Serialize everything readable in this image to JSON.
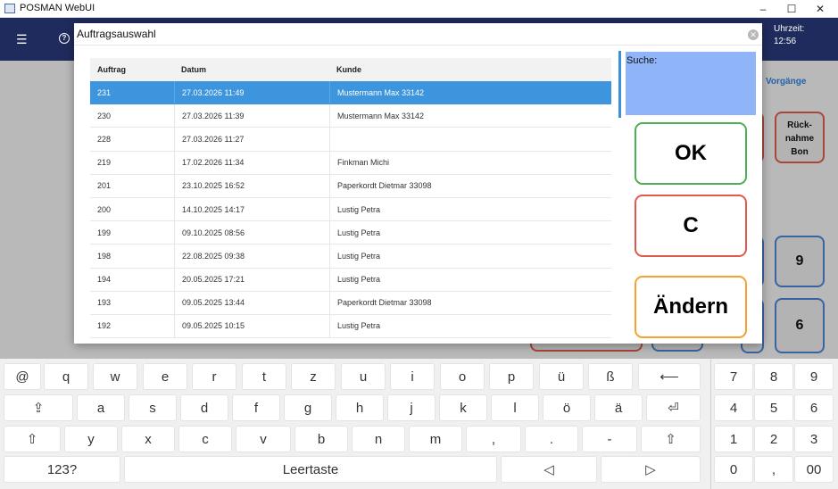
{
  "window": {
    "title": "POSMAN WebUI",
    "minimize": "–",
    "maximize": "☐",
    "close": "✕"
  },
  "header": {
    "menu_icon": "menu-icon",
    "info_icon": "info-icon",
    "time_label": "Uhrzeit:",
    "time_value": "12:56"
  },
  "background": {
    "tab_label": "Vorgänge",
    "tile_ruecknahme": "Rück-\nnahme\nBon",
    "tile_9": "9",
    "tile_6": "6"
  },
  "dialog": {
    "title": "Auftragsauswahl",
    "close_icon": "close-icon",
    "columns": [
      "Auftrag",
      "Datum",
      "Kunde"
    ],
    "rows": [
      {
        "auftrag": "231",
        "datum": "27.03.2026 11:49",
        "kunde": "Mustermann Max 33142",
        "selected": true
      },
      {
        "auftrag": "230",
        "datum": "27.03.2026 11:39",
        "kunde": "Mustermann Max 33142"
      },
      {
        "auftrag": "228",
        "datum": "27.03.2026 11:27",
        "kunde": ""
      },
      {
        "auftrag": "219",
        "datum": "17.02.2026 11:34",
        "kunde": "Finkman Michi"
      },
      {
        "auftrag": "201",
        "datum": "23.10.2025 16:52",
        "kunde": "Paperkordt Dietmar 33098"
      },
      {
        "auftrag": "200",
        "datum": "14.10.2025 14:17",
        "kunde": "Lustig Petra"
      },
      {
        "auftrag": "199",
        "datum": "09.10.2025 08:56",
        "kunde": "Lustig Petra"
      },
      {
        "auftrag": "198",
        "datum": "22.08.2025 09:38",
        "kunde": "Lustig Petra"
      },
      {
        "auftrag": "194",
        "datum": "20.05.2025 17:21",
        "kunde": "Lustig Petra"
      },
      {
        "auftrag": "193",
        "datum": "09.05.2025 13:44",
        "kunde": "Paperkordt Dietmar 33098"
      },
      {
        "auftrag": "192",
        "datum": "09.05.2025 10:15",
        "kunde": "Lustig Petra"
      }
    ],
    "search_label": "Suche:",
    "ok_label": "OK",
    "clear_label": "C",
    "edit_label": "Ändern"
  },
  "colors": {
    "ok_border": "#4caf50",
    "clear_border": "#e05a4a",
    "edit_border": "#f5a030",
    "selection": "#3d95de",
    "header": "#1f2b5c",
    "search_bg": "#8fb4f8"
  },
  "keyboard": {
    "row1": [
      "@",
      "q",
      "w",
      "e",
      "r",
      "t",
      "z",
      "u",
      "i",
      "o",
      "p",
      "ü",
      "ß",
      "⟵"
    ],
    "row2": [
      "⇪",
      "a",
      "s",
      "d",
      "f",
      "g",
      "h",
      "j",
      "k",
      "l",
      "ö",
      "ä",
      "⏎"
    ],
    "row3": [
      "⇧",
      "y",
      "x",
      "c",
      "v",
      "b",
      "n",
      "m",
      ",",
      ".",
      "-",
      "⇧"
    ],
    "row4": [
      "123?",
      "Leertaste",
      "◁",
      "▷"
    ],
    "numpad": [
      "7",
      "8",
      "9",
      "4",
      "5",
      "6",
      "1",
      "2",
      "3",
      "0",
      ",",
      "00"
    ]
  }
}
